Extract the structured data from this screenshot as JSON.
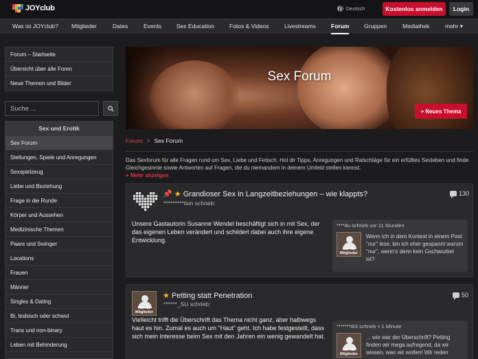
{
  "header": {
    "logo_text": "JOYclub",
    "language": "Deutsch",
    "register_label": "Kostenlos anmelden",
    "login_label": "Login"
  },
  "nav": {
    "items": [
      "Was ist JOYclub?",
      "Mitglieder",
      "Dates",
      "Events",
      "Sex Education",
      "Fotos & Videos",
      "Livestreams",
      "Forum",
      "Gruppen",
      "Mediathek",
      "mehr"
    ],
    "active": "Forum"
  },
  "sidebar": {
    "links": [
      "Forum – Startseite",
      "Übersicht über alle Foren",
      "Neue Themen und Bilder"
    ],
    "search_placeholder": "Suche ...",
    "category_title": "Sex und Erotik",
    "categories": [
      "Sex Forum",
      "Stellungen, Spiele und Anregungen",
      "Sexspielzeug",
      "Liebe und Beziehung",
      "Frage in die Runde",
      "Körper und Aussehen",
      "Medizinische Themen",
      "Paare und Swinger",
      "Locations",
      "Frauen",
      "Männer",
      "Singles & Dating",
      "Bi, lesbisch oder schwul",
      "Trans und non-binary",
      "Leben mit Behinderung"
    ],
    "active_category": "Sex Forum"
  },
  "hero": {
    "title": "Sex Forum",
    "new_topic_label": "+ Neues Thema"
  },
  "breadcrumb": {
    "root": "Forum",
    "separator": ">",
    "current": "Sex Forum"
  },
  "description": {
    "text": "Das Sexforum für alle Fragen rund um Sex, Liebe und Fetisch. Hol dir Tipps, Anregungen und Ratschläge für ein erfülltes Sexleben und finde Gleichgesinnte sowie Antworten auf Fragen, die du niemandem in deinem Umfeld stellen kannst.",
    "more_label": "+ Mehr anzeigen"
  },
  "threads": [
    {
      "pinned": true,
      "starred": true,
      "title": "Grandioser Sex in Langzeitbeziehungen – wie klappts?",
      "author": "*********tion schrieb:",
      "count": "130",
      "excerpt": "Unsere Gastautorin Susanne Wendel beschäftigt sich in mit Sex, der das eigenen Leben verändert und schildert dabei auch ihre eigene Entwicklung.",
      "reply": {
        "head": "****du schrieb vor 11 Stunden",
        "avatar_label": "Nur für Mitglieder",
        "text": "Wenn ich in dem Kontext in einem Post \"nur\" lese, bin ich eher gespannt warum \"nur\", wenn's denn kein Gschwurbel ist?"
      }
    },
    {
      "pinned": false,
      "starred": true,
      "title": "Petting statt Penetration",
      "author": "******_SU schrieb:",
      "count": "50",
      "avatar_label": "Nur für Mitglieder",
      "excerpt": "Vielleicht trifft die Überschrift das Thema nicht ganz, aber halbwegs haut es hin. Zumal es auch um \"Haut\" geht. Ich habe festgestellt, dass sich mein Interesse beim Sex mit den Jahren ein wenig gewandelt hat.",
      "reply": {
        "head": "*******t63 schrieb < 1 Minute",
        "avatar_label": "Nur für Mitglieder",
        "text": "... wie war der Überschrift? Petting finden wir mega aufregend, da wir wissen, was wir wollen! Wir reden"
      }
    }
  ],
  "colors": {
    "accent": "#c8102e",
    "background": "#1c1c1e",
    "panel": "#2a2a2c"
  }
}
